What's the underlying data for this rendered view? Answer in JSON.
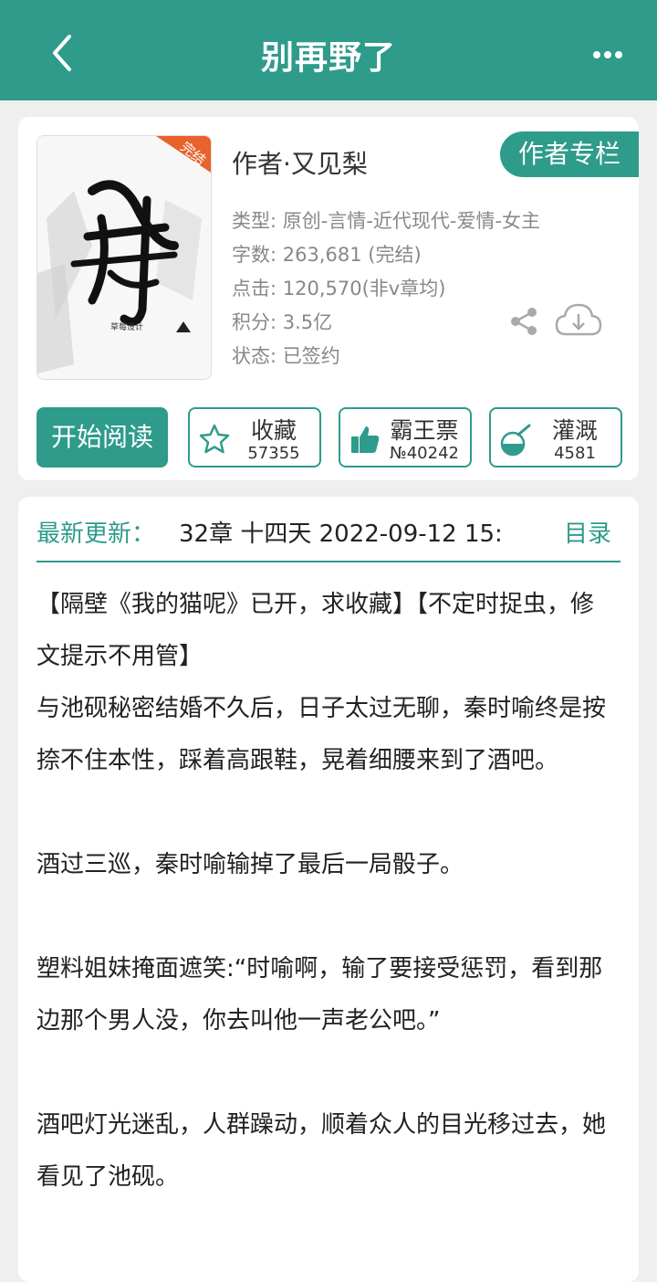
{
  "header": {
    "title": "别再野了",
    "back_icon": "back-chevron-icon",
    "more_icon": "more-dots-icon"
  },
  "book": {
    "cover_badge": "完结",
    "cover_title_art": "别再野了",
    "cover_publisher": "草莓设计",
    "author_line": "作者·又见梨",
    "author_column_button": "作者专栏",
    "info": {
      "type": "类型: 原创-言情-近代现代-爱情-女主",
      "words": "字数: 263,681 (完结)",
      "clicks": "点击: 120,570(非v章均)",
      "score": "积分: 3.5亿",
      "status": "状态: 已签约"
    }
  },
  "actions": {
    "read": "开始阅读",
    "favorite": {
      "label": "收藏",
      "count": "57355"
    },
    "vote": {
      "label": "霸王票",
      "count": "№40242"
    },
    "water": {
      "label": "灌溉",
      "count": "4581"
    }
  },
  "latest": {
    "label": "最新更新：",
    "text": "32章  十四天  2022-09-12 15:",
    "toc": "目录"
  },
  "synopsis": "【隔壁《我的猫呢》已开，求收藏】【不定时捉虫，修文提示不用管】\n与池砚秘密结婚不久后，日子太过无聊，秦时喻终是按捺不住本性，踩着高跟鞋，晃着细腰来到了酒吧。\n\n酒过三巡，秦时喻输掉了最后一局骰子。\n\n塑料姐妹掩面遮笑:“时喻啊，输了要接受惩罚，看到那边那个男人没，你去叫他一声老公吧。”\n\n酒吧灯光迷乱，人群躁动，顺着众人的目光移过去，她看见了池砚。",
  "colors": {
    "accent": "#2e9b8b",
    "page_bg": "#efefef",
    "card_bg": "#ffffff",
    "muted_text": "#888888"
  }
}
